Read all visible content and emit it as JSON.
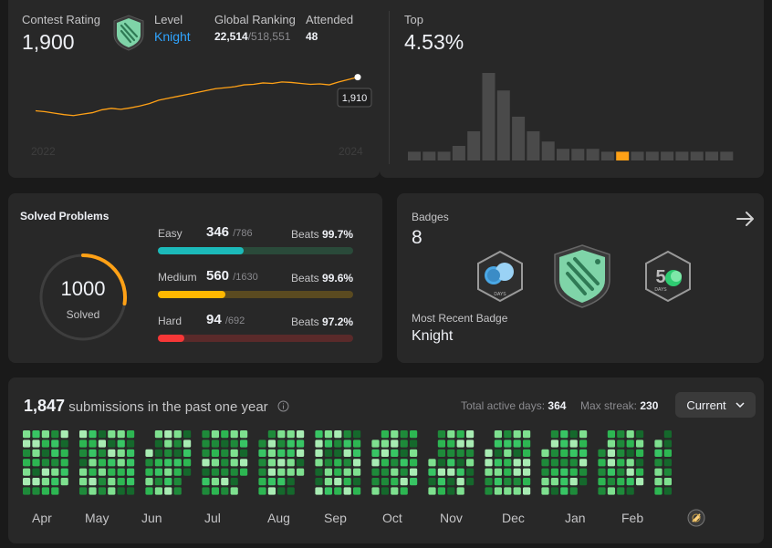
{
  "contest": {
    "rating_label": "Contest Rating",
    "rating_value": "1,900",
    "level_label": "Level",
    "level_value": "Knight",
    "global_label": "Global Ranking",
    "global_rank": "22,514",
    "global_total": "/518,551",
    "attended_label": "Attended",
    "attended_value": "48",
    "x_start": "2022",
    "x_end": "2024",
    "tooltip": "1,910",
    "line_color": "#ffa116",
    "rating_series": [
      1840,
      1838,
      1835,
      1832,
      1830,
      1833,
      1836,
      1842,
      1845,
      1843,
      1846,
      1850,
      1855,
      1862,
      1866,
      1870,
      1874,
      1878,
      1882,
      1886,
      1888,
      1890,
      1894,
      1895,
      1898,
      1897,
      1900,
      1899,
      1897,
      1895,
      1896,
      1894,
      1900,
      1905,
      1910
    ]
  },
  "top": {
    "label": "Top",
    "value": "4.53%",
    "highlight_index": 14,
    "highlight_color": "#ffa116",
    "histogram": [
      6,
      6,
      6,
      10,
      20,
      60,
      48,
      30,
      20,
      13,
      8,
      8,
      8,
      6,
      6,
      6,
      6,
      6,
      6,
      6,
      6,
      6
    ]
  },
  "solved": {
    "title": "Solved Problems",
    "total": "1000",
    "total_label": "Solved",
    "rows": [
      {
        "name": "Easy",
        "count": "346",
        "of": "/786",
        "beats_label": "Beats",
        "beats": "99.7%",
        "fraction": 0.44,
        "color": "#1cbaba",
        "track": "#2a4a3a"
      },
      {
        "name": "Medium",
        "count": "560",
        "of": "/1630",
        "beats_label": "Beats",
        "beats": "99.6%",
        "fraction": 0.344,
        "color": "#ffb800",
        "track": "#5a4a20"
      },
      {
        "name": "Hard",
        "count": "94",
        "of": "/692",
        "beats_label": "Beats",
        "beats": "97.2%",
        "fraction": 0.136,
        "color": "#f63737",
        "track": "#5a2a2a"
      }
    ]
  },
  "badges": {
    "title": "Badges",
    "count": "8",
    "recent_label": "Most Recent Badge",
    "recent_value": "Knight",
    "badge1_text": "DAYS",
    "badge3_text": "DAYS"
  },
  "submissions": {
    "count": "1,847",
    "text": "submissions in the past one year",
    "active_label": "Total active days:",
    "active_value": "364",
    "streak_label": "Max streak:",
    "streak_value": "230",
    "dropdown": "Current",
    "months": [
      "Apr",
      "May",
      "Jun",
      "Jul",
      "Aug",
      "Sep",
      "Oct",
      "Nov",
      "Dec",
      "Jan",
      "Feb"
    ]
  }
}
